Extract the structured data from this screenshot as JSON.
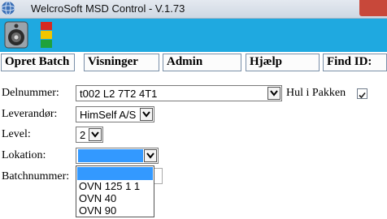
{
  "window": {
    "title": "WelcroSoft MSD Control -  V.1.73"
  },
  "toolbar": {
    "speaker_icon": "speaker-icon",
    "traffic_light_icon": "traffic-light-icon",
    "colors": {
      "background": "#1fa9e0",
      "red": "#d62a20",
      "yellow": "#f0c500",
      "green": "#1fa23a"
    }
  },
  "menu": [
    {
      "label": "Opret Batch"
    },
    {
      "label": "Visninger"
    },
    {
      "label": "Admin"
    },
    {
      "label": "Hjælp"
    },
    {
      "label": "Find ID:"
    }
  ],
  "form": {
    "delnummer": {
      "label": "Delnummer:",
      "value": "t002 L2 7T2 4T1"
    },
    "hul_i_pakken": {
      "label": "Hul i Pakken",
      "checked": true
    },
    "leverandor": {
      "label": "Leverandør:",
      "value": "HimSelf A/S"
    },
    "level": {
      "label": "Level:",
      "value": "2"
    },
    "lokation": {
      "label": "Lokation:",
      "value": "",
      "options": [
        "",
        "OVN 125 1 1",
        "OVN 40",
        "OVN 90"
      ]
    },
    "batchnummer": {
      "label": "Batchnummer:"
    }
  }
}
